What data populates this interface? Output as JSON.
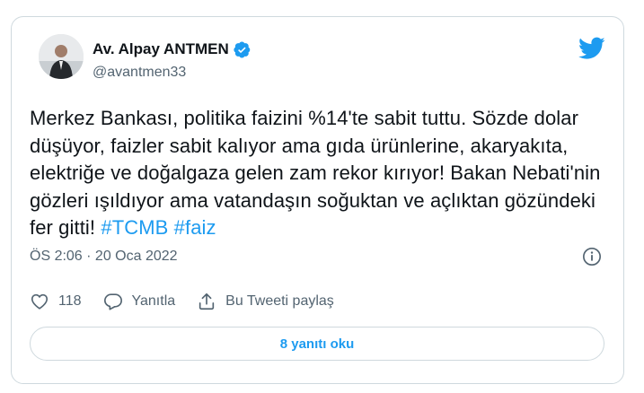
{
  "author": {
    "name": "Av. Alpay ANTMEN",
    "handle": "@avantmen33"
  },
  "tweet": {
    "text": "Merkez Bankası, politika faizini %14'te sabit tuttu. Sözde dolar düşüyor, faizler sabit kalıyor ama gıda ürünlerine, akaryakıta, elektriğe ve doğalgaza gelen zam rekor kırıyor! Bakan Nebati'nin gözleri ışıldıyor ama vatandaşın soğuktan ve açlıktan gözündeki fer gitti!",
    "hashtag_1": "#TCMB",
    "hashtag_2": "#faiz",
    "timestamp": "ÖS 2:06 · 20 Oca 2022"
  },
  "actions": {
    "like_count": "118",
    "reply_label": "Yanıtla",
    "share_label": "Bu Tweeti paylaş"
  },
  "read_replies_label": "8 yanıtı oku",
  "colors": {
    "accent": "#1d9bf0",
    "secondary_text": "#536471",
    "border": "#cfd9de"
  },
  "icons": [
    "verified-badge-icon",
    "twitter-bird-icon",
    "info-icon",
    "heart-icon",
    "reply-bubble-icon",
    "share-icon"
  ]
}
